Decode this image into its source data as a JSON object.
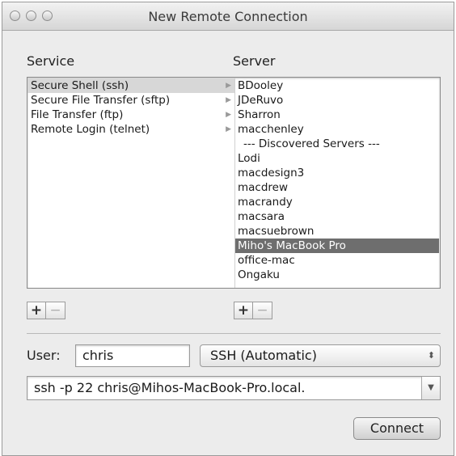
{
  "window": {
    "title": "New Remote Connection"
  },
  "service": {
    "heading": "Service",
    "items": [
      {
        "label": "Secure Shell (ssh)"
      },
      {
        "label": "Secure File Transfer (sftp)"
      },
      {
        "label": "File Transfer (ftp)"
      },
      {
        "label": "Remote Login (telnet)"
      }
    ],
    "selected_index": 0
  },
  "server": {
    "heading": "Server",
    "items": [
      {
        "label": "BDooley"
      },
      {
        "label": "JDeRuvo"
      },
      {
        "label": "Sharron"
      },
      {
        "label": "macchenley"
      },
      {
        "label": "--- Discovered Servers ---"
      },
      {
        "label": "Lodi"
      },
      {
        "label": "macdesign3"
      },
      {
        "label": "macdrew"
      },
      {
        "label": "macrandy"
      },
      {
        "label": "macsara"
      },
      {
        "label": "macsuebrown"
      },
      {
        "label": "Miho's MacBook Pro"
      },
      {
        "label": "office-mac"
      },
      {
        "label": "Ongaku"
      }
    ],
    "selected_index": 11
  },
  "buttons": {
    "add": "+",
    "remove": "−",
    "connect": "Connect"
  },
  "user": {
    "label": "User:",
    "value": "chris"
  },
  "protocol_select": {
    "value": "SSH (Automatic)"
  },
  "command": {
    "value": "ssh -p 22 chris@Mihos-MacBook-Pro.local."
  },
  "icons": {
    "submenu_arrow": "▶",
    "updown": "⬍",
    "dropdown": "▼"
  }
}
